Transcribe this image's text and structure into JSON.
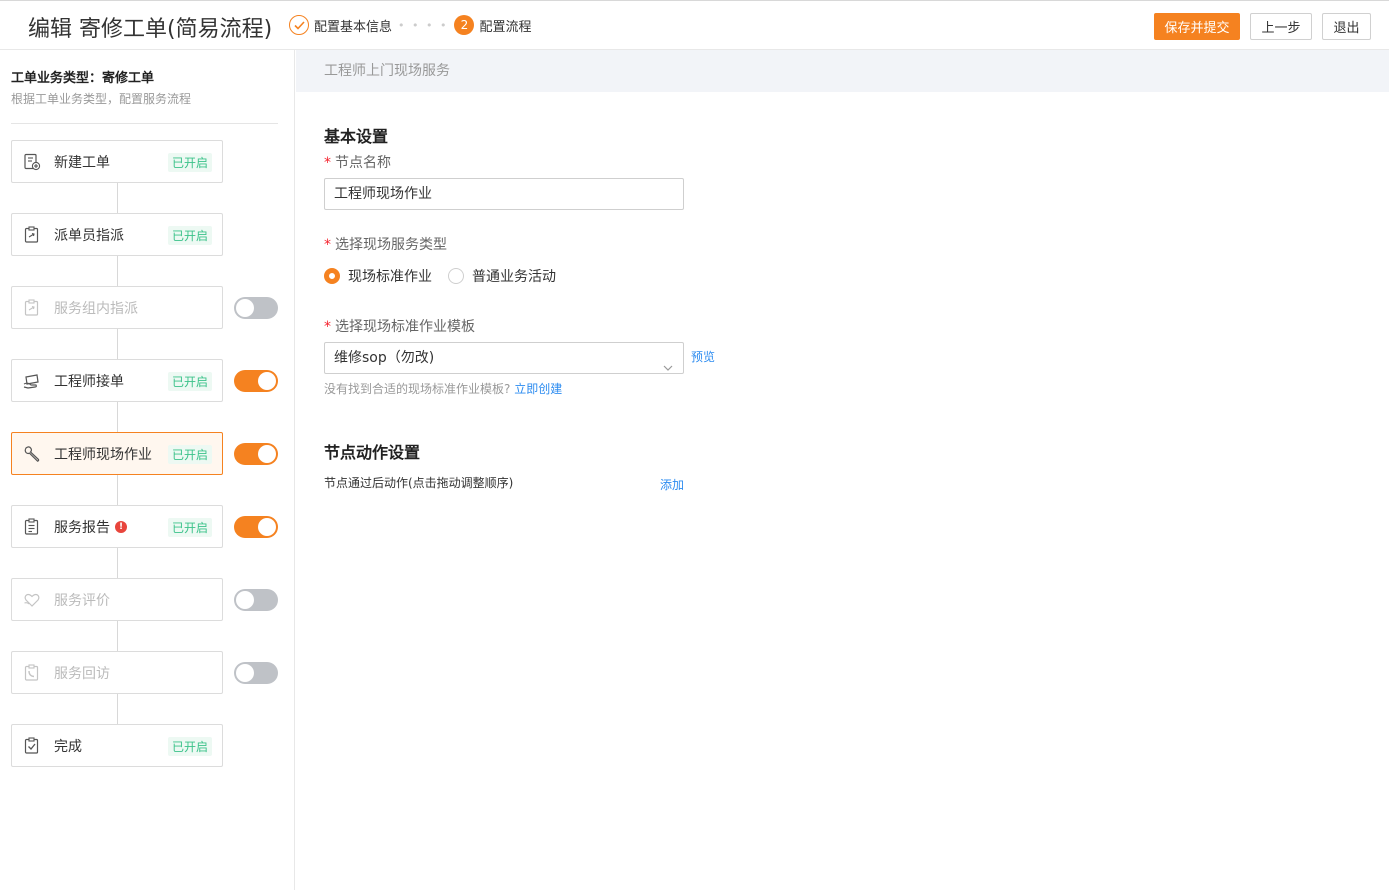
{
  "header": {
    "title": "编辑 寄修工单(简易流程)",
    "steps": [
      {
        "label": "配置基本信息",
        "state": "done"
      },
      {
        "number": "2",
        "label": "配置流程",
        "state": "current"
      }
    ],
    "buttons": {
      "save": "保存并提交",
      "prev": "上一步",
      "exit": "退出"
    }
  },
  "sidebar": {
    "biz_type": "工单业务类型：寄修工单",
    "biz_desc": "根据工单业务类型，配置服务流程",
    "nodes": [
      {
        "label": "新建工单",
        "badge": "已开启",
        "icon": "new-order-icon",
        "enabled": true
      },
      {
        "label": "派单员指派",
        "badge": "已开启",
        "icon": "dispatch-icon",
        "enabled": true
      },
      {
        "label": "服务组内指派",
        "badge": "",
        "icon": "group-assign-icon",
        "enabled": false
      },
      {
        "label": "工程师接单",
        "badge": "已开启",
        "icon": "accept-order-icon",
        "enabled": true
      },
      {
        "label": "工程师现场作业",
        "badge": "已开启",
        "icon": "wrench-icon",
        "enabled": true
      },
      {
        "label": "服务报告",
        "badge": "已开启",
        "icon": "report-icon",
        "enabled": true,
        "warning": "!"
      },
      {
        "label": "服务评价",
        "badge": "",
        "icon": "rating-icon",
        "enabled": false
      },
      {
        "label": "服务回访",
        "badge": "",
        "icon": "revisit-icon",
        "enabled": false
      },
      {
        "label": "完成",
        "badge": "已开启",
        "icon": "complete-icon",
        "enabled": true
      }
    ]
  },
  "main": {
    "header": "工程师上门现场服务",
    "basic_title": "基本设置",
    "node_name_label": "节点名称",
    "node_name_value": "工程师现场作业",
    "service_type_label": "选择现场服务类型",
    "service_type_options": [
      "现场标准作业",
      "普通业务活动"
    ],
    "service_type_selected": "现场标准作业",
    "template_label": "选择现场标准作业模板",
    "template_value": "维修sop（勿改)",
    "preview_link": "预览",
    "hint_text": "没有找到合适的现场标准作业模板?",
    "create_link": "立即创建",
    "action_title": "节点动作设置",
    "action_desc": "节点通过后动作(点击拖动调整顺序)",
    "add_link": "添加"
  },
  "colors": {
    "accent": "#f58220",
    "enabled_badge": "#3cc28a",
    "link": "#2d8cf0"
  }
}
